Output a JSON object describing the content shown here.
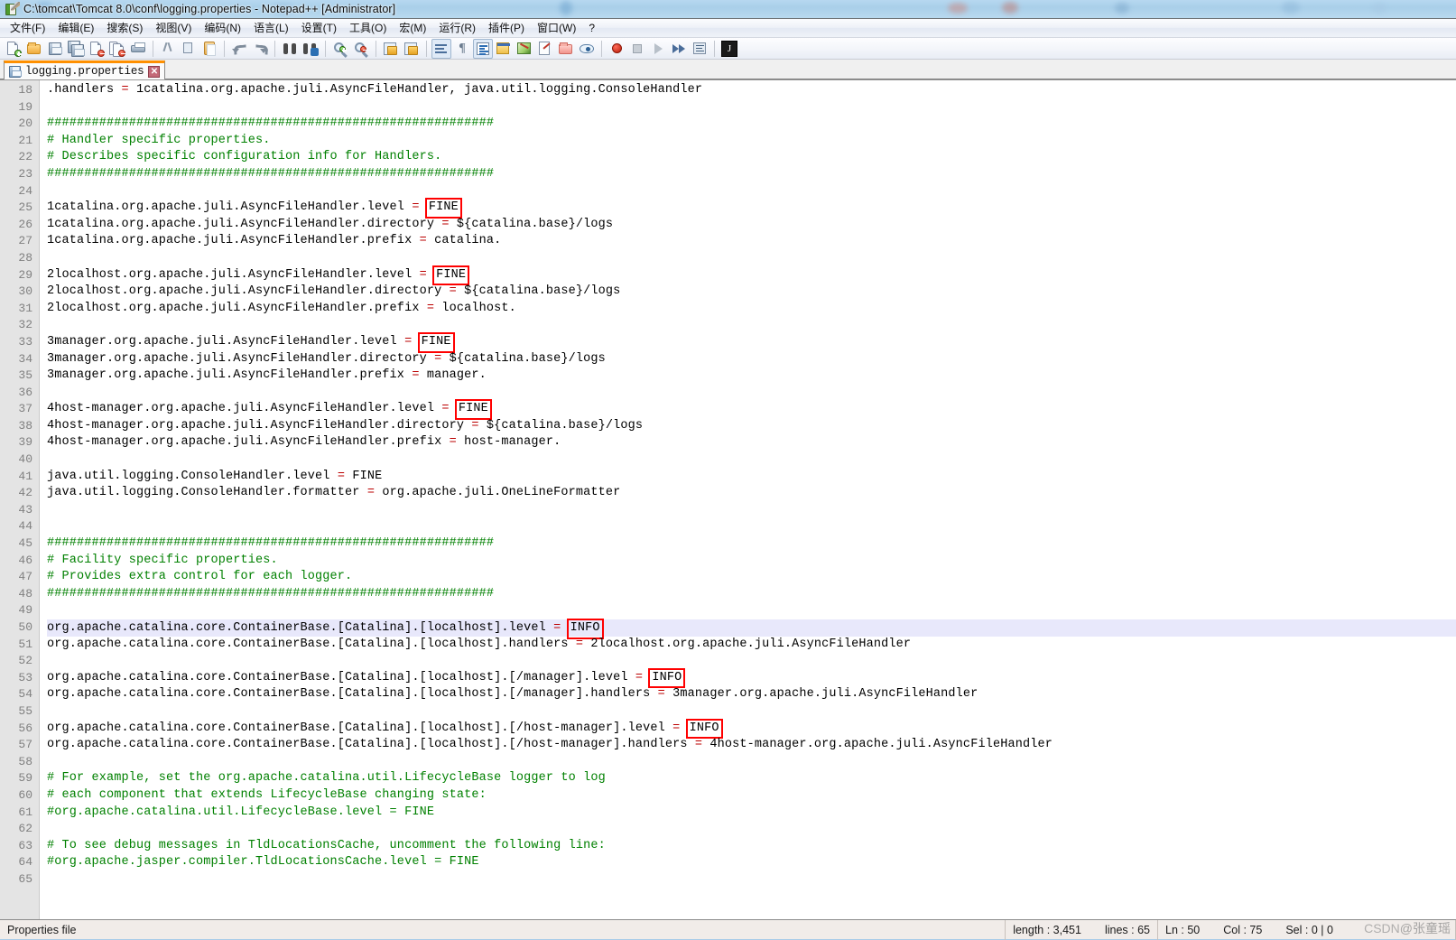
{
  "window": {
    "title": "C:\\tomcat\\Tomcat 8.0\\conf\\logging.properties - Notepad++ [Administrator]",
    "app_icon": "notepad-plus-plus-icon"
  },
  "menu": {
    "items": [
      {
        "label": "文件(F)",
        "name": "menu-file"
      },
      {
        "label": "编辑(E)",
        "name": "menu-edit"
      },
      {
        "label": "搜索(S)",
        "name": "menu-search"
      },
      {
        "label": "视图(V)",
        "name": "menu-view"
      },
      {
        "label": "编码(N)",
        "name": "menu-encoding"
      },
      {
        "label": "语言(L)",
        "name": "menu-language"
      },
      {
        "label": "设置(T)",
        "name": "menu-settings"
      },
      {
        "label": "工具(O)",
        "name": "menu-tools"
      },
      {
        "label": "宏(M)",
        "name": "menu-macro"
      },
      {
        "label": "运行(R)",
        "name": "menu-run"
      },
      {
        "label": "插件(P)",
        "name": "menu-plugins"
      },
      {
        "label": "窗口(W)",
        "name": "menu-window"
      },
      {
        "label": "?",
        "name": "menu-help"
      }
    ]
  },
  "toolbar": {
    "icons": [
      "new-file-icon",
      "open-file-icon",
      "save-icon",
      "save-all-icon",
      "close-file-icon",
      "close-all-files-icon",
      "print-icon",
      "cut-icon",
      "copy-icon",
      "paste-icon",
      "undo-icon",
      "redo-icon",
      "find-icon",
      "replace-icon",
      "zoom-in-icon",
      "zoom-out-icon",
      "sync-vertical-scroll-icon",
      "sync-horizontal-scroll-icon",
      "word-wrap-icon",
      "show-all-characters-icon",
      "indent-guideline-icon",
      "user-defined-dialog-icon",
      "document-map-icon",
      "function-list-icon",
      "folder-as-workspace-icon",
      "monitoring-icon",
      "record-macro-icon",
      "stop-recording-icon",
      "playback-macro-icon",
      "run-macro-multiple-icon",
      "save-macro-icon",
      "run-icon"
    ]
  },
  "tab": {
    "label": "logging.properties",
    "save_icon": "floppy-save-icon",
    "close_icon": "close-tab-icon"
  },
  "editor": {
    "first_line_number": 18,
    "highlighted_line": 50,
    "lines": [
      {
        "n": 18,
        "segments": [
          {
            "t": ".handlers ",
            "c": "plain"
          },
          {
            "t": "=",
            "c": "eq"
          },
          {
            "t": " 1catalina.org.apache.juli.AsyncFileHandler, java.util.logging.ConsoleHandler",
            "c": "plain"
          }
        ]
      },
      {
        "n": 19,
        "segments": []
      },
      {
        "n": 20,
        "segments": [
          {
            "t": "############################################################",
            "c": "cmt"
          }
        ]
      },
      {
        "n": 21,
        "segments": [
          {
            "t": "# Handler specific properties.",
            "c": "cmt"
          }
        ]
      },
      {
        "n": 22,
        "segments": [
          {
            "t": "# Describes specific configuration info for Handlers.",
            "c": "cmt"
          }
        ]
      },
      {
        "n": 23,
        "segments": [
          {
            "t": "############################################################",
            "c": "cmt"
          }
        ]
      },
      {
        "n": 24,
        "segments": []
      },
      {
        "n": 25,
        "segments": [
          {
            "t": "1catalina.org.apache.juli.AsyncFileHandler.level ",
            "c": "plain"
          },
          {
            "t": "=",
            "c": "eq"
          },
          {
            "t": " ",
            "c": "plain"
          },
          {
            "t": "FINE",
            "c": "box"
          }
        ]
      },
      {
        "n": 26,
        "segments": [
          {
            "t": "1catalina.org.apache.juli.AsyncFileHandler.directory ",
            "c": "plain"
          },
          {
            "t": "=",
            "c": "eq"
          },
          {
            "t": " ${catalina.base}/logs",
            "c": "plain"
          }
        ]
      },
      {
        "n": 27,
        "segments": [
          {
            "t": "1catalina.org.apache.juli.AsyncFileHandler.prefix ",
            "c": "plain"
          },
          {
            "t": "=",
            "c": "eq"
          },
          {
            "t": " catalina.",
            "c": "plain"
          }
        ]
      },
      {
        "n": 28,
        "segments": []
      },
      {
        "n": 29,
        "segments": [
          {
            "t": "2localhost.org.apache.juli.AsyncFileHandler.level ",
            "c": "plain"
          },
          {
            "t": "=",
            "c": "eq"
          },
          {
            "t": " ",
            "c": "plain"
          },
          {
            "t": "FINE",
            "c": "box"
          }
        ]
      },
      {
        "n": 30,
        "segments": [
          {
            "t": "2localhost.org.apache.juli.AsyncFileHandler.directory ",
            "c": "plain"
          },
          {
            "t": "=",
            "c": "eq"
          },
          {
            "t": " ${catalina.base}/logs",
            "c": "plain"
          }
        ]
      },
      {
        "n": 31,
        "segments": [
          {
            "t": "2localhost.org.apache.juli.AsyncFileHandler.prefix ",
            "c": "plain"
          },
          {
            "t": "=",
            "c": "eq"
          },
          {
            "t": " localhost.",
            "c": "plain"
          }
        ]
      },
      {
        "n": 32,
        "segments": []
      },
      {
        "n": 33,
        "segments": [
          {
            "t": "3manager.org.apache.juli.AsyncFileHandler.level ",
            "c": "plain"
          },
          {
            "t": "=",
            "c": "eq"
          },
          {
            "t": " ",
            "c": "plain"
          },
          {
            "t": "FINE",
            "c": "box"
          }
        ]
      },
      {
        "n": 34,
        "segments": [
          {
            "t": "3manager.org.apache.juli.AsyncFileHandler.directory ",
            "c": "plain"
          },
          {
            "t": "=",
            "c": "eq"
          },
          {
            "t": " ${catalina.base}/logs",
            "c": "plain"
          }
        ]
      },
      {
        "n": 35,
        "segments": [
          {
            "t": "3manager.org.apache.juli.AsyncFileHandler.prefix ",
            "c": "plain"
          },
          {
            "t": "=",
            "c": "eq"
          },
          {
            "t": " manager.",
            "c": "plain"
          }
        ]
      },
      {
        "n": 36,
        "segments": []
      },
      {
        "n": 37,
        "segments": [
          {
            "t": "4host-manager.org.apache.juli.AsyncFileHandler.level ",
            "c": "plain"
          },
          {
            "t": "=",
            "c": "eq"
          },
          {
            "t": " ",
            "c": "plain"
          },
          {
            "t": "FINE",
            "c": "box"
          }
        ]
      },
      {
        "n": 38,
        "segments": [
          {
            "t": "4host-manager.org.apache.juli.AsyncFileHandler.directory ",
            "c": "plain"
          },
          {
            "t": "=",
            "c": "eq"
          },
          {
            "t": " ${catalina.base}/logs",
            "c": "plain"
          }
        ]
      },
      {
        "n": 39,
        "segments": [
          {
            "t": "4host-manager.org.apache.juli.AsyncFileHandler.prefix ",
            "c": "plain"
          },
          {
            "t": "=",
            "c": "eq"
          },
          {
            "t": " host-manager.",
            "c": "plain"
          }
        ]
      },
      {
        "n": 40,
        "segments": []
      },
      {
        "n": 41,
        "segments": [
          {
            "t": "java.util.logging.ConsoleHandler.level ",
            "c": "plain"
          },
          {
            "t": "=",
            "c": "eq"
          },
          {
            "t": " FINE",
            "c": "plain"
          }
        ]
      },
      {
        "n": 42,
        "segments": [
          {
            "t": "java.util.logging.ConsoleHandler.formatter ",
            "c": "plain"
          },
          {
            "t": "=",
            "c": "eq"
          },
          {
            "t": " org.apache.juli.OneLineFormatter",
            "c": "plain"
          }
        ]
      },
      {
        "n": 43,
        "segments": []
      },
      {
        "n": 44,
        "segments": []
      },
      {
        "n": 45,
        "segments": [
          {
            "t": "############################################################",
            "c": "cmt"
          }
        ]
      },
      {
        "n": 46,
        "segments": [
          {
            "t": "# Facility specific properties.",
            "c": "cmt"
          }
        ]
      },
      {
        "n": 47,
        "segments": [
          {
            "t": "# Provides extra control for each logger.",
            "c": "cmt"
          }
        ]
      },
      {
        "n": 48,
        "segments": [
          {
            "t": "############################################################",
            "c": "cmt"
          }
        ]
      },
      {
        "n": 49,
        "segments": []
      },
      {
        "n": 50,
        "segments": [
          {
            "t": "org.apache.catalina.core.ContainerBase.[Catalina].[localhost].level ",
            "c": "plain"
          },
          {
            "t": "=",
            "c": "eq"
          },
          {
            "t": " ",
            "c": "plain"
          },
          {
            "t": "INFO",
            "c": "box-caret"
          }
        ]
      },
      {
        "n": 51,
        "segments": [
          {
            "t": "org.apache.catalina.core.ContainerBase.[Catalina].[localhost].handlers ",
            "c": "plain"
          },
          {
            "t": "=",
            "c": "eq"
          },
          {
            "t": " 2localhost.org.apache.juli.AsyncFileHandler",
            "c": "plain"
          }
        ]
      },
      {
        "n": 52,
        "segments": []
      },
      {
        "n": 53,
        "segments": [
          {
            "t": "org.apache.catalina.core.ContainerBase.[Catalina].[localhost].[/manager].level ",
            "c": "plain"
          },
          {
            "t": "=",
            "c": "eq"
          },
          {
            "t": " ",
            "c": "plain"
          },
          {
            "t": "INFO",
            "c": "box"
          }
        ]
      },
      {
        "n": 54,
        "segments": [
          {
            "t": "org.apache.catalina.core.ContainerBase.[Catalina].[localhost].[/manager].handlers ",
            "c": "plain"
          },
          {
            "t": "=",
            "c": "eq"
          },
          {
            "t": " 3manager.org.apache.juli.AsyncFileHandler",
            "c": "plain"
          }
        ]
      },
      {
        "n": 55,
        "segments": []
      },
      {
        "n": 56,
        "segments": [
          {
            "t": "org.apache.catalina.core.ContainerBase.[Catalina].[localhost].[/host-manager].level ",
            "c": "plain"
          },
          {
            "t": "=",
            "c": "eq"
          },
          {
            "t": " ",
            "c": "plain"
          },
          {
            "t": "INFO",
            "c": "box"
          }
        ]
      },
      {
        "n": 57,
        "segments": [
          {
            "t": "org.apache.catalina.core.ContainerBase.[Catalina].[localhost].[/host-manager].handlers ",
            "c": "plain"
          },
          {
            "t": "=",
            "c": "eq"
          },
          {
            "t": " 4host-manager.org.apache.juli.AsyncFileHandler",
            "c": "plain"
          }
        ]
      },
      {
        "n": 58,
        "segments": []
      },
      {
        "n": 59,
        "segments": [
          {
            "t": "# For example, set the org.apache.catalina.util.LifecycleBase logger to log",
            "c": "cmt"
          }
        ]
      },
      {
        "n": 60,
        "segments": [
          {
            "t": "# each component that extends LifecycleBase changing state:",
            "c": "cmt"
          }
        ]
      },
      {
        "n": 61,
        "segments": [
          {
            "t": "#org.apache.catalina.util.LifecycleBase.level = FINE",
            "c": "cmt"
          }
        ]
      },
      {
        "n": 62,
        "segments": []
      },
      {
        "n": 63,
        "segments": [
          {
            "t": "# To see debug messages in TldLocationsCache, uncomment the following line:",
            "c": "cmt"
          }
        ]
      },
      {
        "n": 64,
        "segments": [
          {
            "t": "#org.apache.jasper.compiler.TldLocationsCache.level = FINE",
            "c": "cmt"
          }
        ]
      },
      {
        "n": 65,
        "segments": []
      }
    ]
  },
  "status_bar": {
    "file_type": "Properties file",
    "length_label": "length : 3,451",
    "lines_label": "lines : 65",
    "ln_label": "Ln : 50",
    "col_label": "Col : 75",
    "sel_label": "Sel : 0 | 0",
    "watermark_prefix": "CSDN",
    "watermark_text": "@张童瑶"
  },
  "colors": {
    "comment_green": "#008000",
    "operator_red": "#bb0000",
    "highlight_box_red": "#ff0000",
    "current_line": "#e8e8fb",
    "tab_active_accent": "#ff9000"
  }
}
